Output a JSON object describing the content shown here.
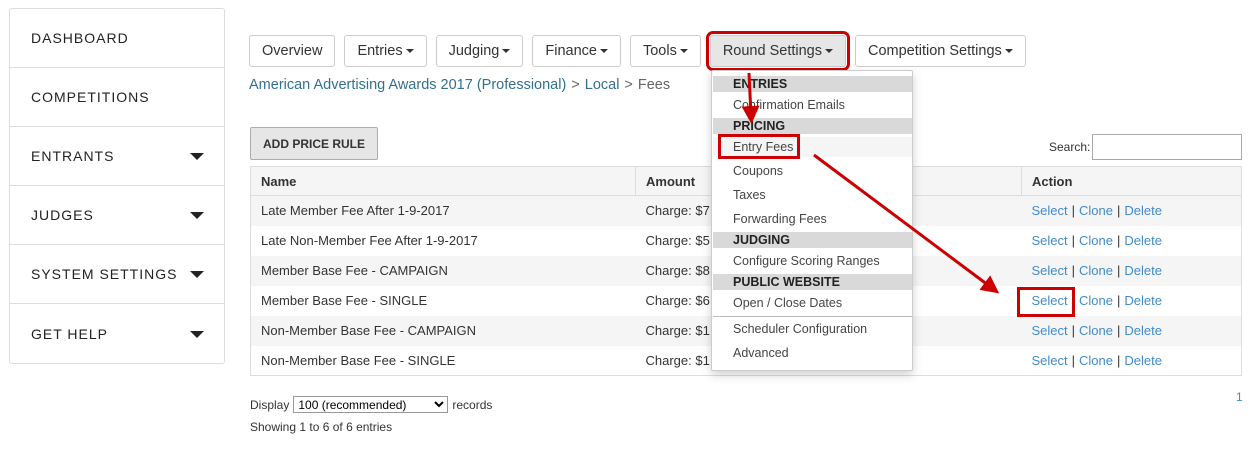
{
  "sidebar": {
    "items": [
      {
        "label": "DASHBOARD",
        "has_caret": false
      },
      {
        "label": "COMPETITIONS",
        "has_caret": false
      },
      {
        "label": "ENTRANTS",
        "has_caret": true
      },
      {
        "label": "JUDGES",
        "has_caret": true
      },
      {
        "label": "SYSTEM SETTINGS",
        "has_caret": true
      },
      {
        "label": "GET HELP",
        "has_caret": true
      }
    ]
  },
  "topnav": {
    "overview": "Overview",
    "entries": "Entries",
    "judging": "Judging",
    "finance": "Finance",
    "tools": "Tools",
    "round_settings": "Round Settings",
    "competition_settings": "Competition Settings"
  },
  "breadcrumb": {
    "competition": "American Advertising Awards 2017 (Professional)",
    "round": "Local",
    "current": "Fees",
    "separator": ">"
  },
  "toolbar": {
    "add_price_rule": "ADD PRICE RULE",
    "search_label": "Search:",
    "search_value": ""
  },
  "table": {
    "headers": {
      "name": "Name",
      "amount": "Amount",
      "action": "Action"
    },
    "rows": [
      {
        "name": "Late Member Fee After 1-9-2017",
        "amount": "Charge: $7"
      },
      {
        "name": "Late Non-Member Fee After 1-9-2017",
        "amount": "Charge: $5"
      },
      {
        "name": "Member Base Fee - CAMPAIGN",
        "amount": "Charge: $8"
      },
      {
        "name": "Member Base Fee - SINGLE",
        "amount": "Charge: $6"
      },
      {
        "name": "Non-Member Base Fee - CAMPAIGN",
        "amount": "Charge: $1"
      },
      {
        "name": "Non-Member Base Fee - SINGLE",
        "amount": "Charge: $1"
      }
    ],
    "action_labels": {
      "select": "Select",
      "clone": "Clone",
      "delete": "Delete",
      "separator": "|"
    }
  },
  "footer": {
    "display_label": "Display",
    "display_value": "100 (recommended)",
    "records_label": "records",
    "showing": "Showing 1 to 6 of 6 entries",
    "page": "1"
  },
  "dropdown": {
    "sections": [
      {
        "header": "ENTRIES",
        "items": [
          "Confirmation Emails"
        ]
      },
      {
        "header": "PRICING",
        "items": [
          "Entry Fees",
          "Coupons",
          "Taxes",
          "Forwarding Fees"
        ]
      },
      {
        "header": "JUDGING",
        "items": [
          "Configure Scoring Ranges"
        ]
      },
      {
        "header": "PUBLIC WEBSITE",
        "items": [
          "Open / Close Dates"
        ]
      }
    ],
    "extra_items": [
      "Scheduler Configuration",
      "Advanced"
    ]
  },
  "colors": {
    "link": "#428bca",
    "breadcrumb_link": "#31708f",
    "annotation": "#cc0000"
  }
}
